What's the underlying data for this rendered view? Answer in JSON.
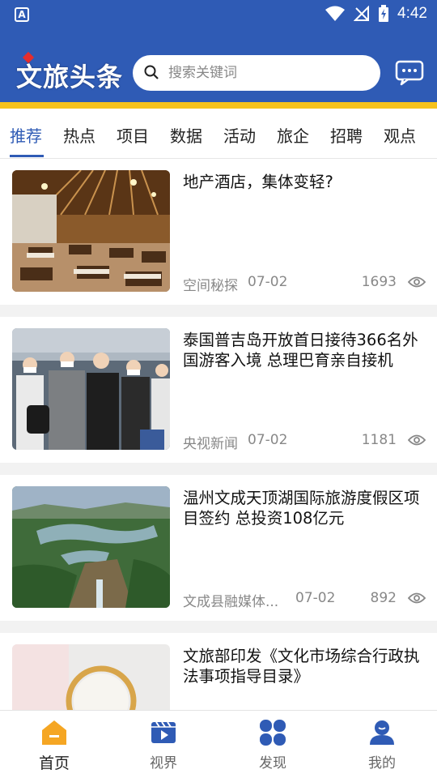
{
  "status": {
    "time": "4:42"
  },
  "header": {
    "logo": "文旅头条",
    "search_placeholder": "搜索关键词"
  },
  "tabs": [
    "推荐",
    "热点",
    "项目",
    "数据",
    "活动",
    "旅企",
    "招聘",
    "观点"
  ],
  "articles": [
    {
      "title": "地产酒店，集体变轻?",
      "source": "空间秘探",
      "date": "07-02",
      "views": "1693"
    },
    {
      "title": "泰国普吉岛开放首日接待366名外国游客入境 总理巴育亲自接机",
      "source": "央视新闻",
      "date": "07-02",
      "views": "1181"
    },
    {
      "title": "温州文成天顶湖国际旅游度假区项目签约 总投资108亿元",
      "source": "文成县融媒体...",
      "date": "07-02",
      "views": "892"
    },
    {
      "title": "文旅部印发《文化市场综合行政执法事项指导目录》",
      "source": "",
      "date": "",
      "views": ""
    }
  ],
  "bottom_nav": [
    "首页",
    "视界",
    "发现",
    "我的"
  ],
  "colors": {
    "brand_blue": "#2f5bb5",
    "accent_yellow": "#f6c21c",
    "home_orange": "#f5a623"
  }
}
